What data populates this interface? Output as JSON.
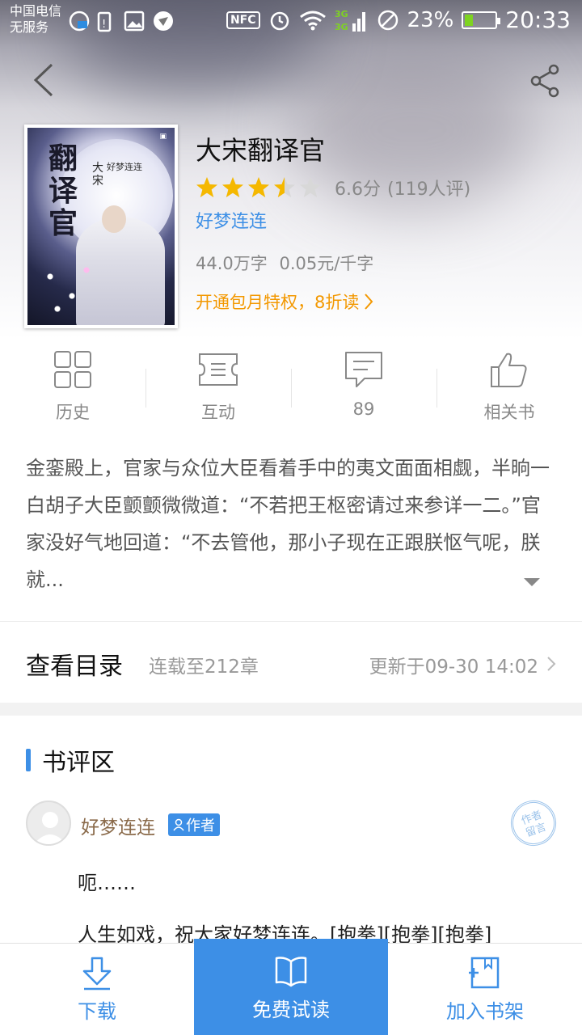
{
  "status_bar": {
    "carrier_line1": "中国电信",
    "carrier_line2": "无服务",
    "nfc": "NFC",
    "network": "3G",
    "battery_pct": "23%",
    "time": "20:33"
  },
  "book": {
    "title": "大宋翻译官",
    "rating_stars": 3.5,
    "score": "6.6分",
    "review_count": "(119人评)",
    "author": "好梦连连",
    "word_count": "44.0万字",
    "price": "0.05元/千字",
    "promo": "开通包月特权，8折读"
  },
  "cover": {
    "title_chars": "翻译官",
    "subtitle": "大宋",
    "author": "好梦连连"
  },
  "actions": [
    {
      "label": "历史",
      "icon": "grid-icon"
    },
    {
      "label": "互动",
      "icon": "ticket-icon"
    },
    {
      "label": "89",
      "icon": "comment-icon"
    },
    {
      "label": "相关书",
      "icon": "thumbs-up-icon"
    }
  ],
  "synopsis": "金銮殿上，官家与众位大臣看着手中的夷文面面相觑，半晌一白胡子大臣颤颤微微道：“不若把王枢密请过来参详一二。”官家没好气地回道：“不去管他，那小子现在正跟朕怄气呢，朕就...",
  "catalog": {
    "title": "查看目录",
    "status": "连载至212章",
    "updated": "更新于09-30 14:02"
  },
  "reviews": {
    "title": "书评区",
    "items": [
      {
        "user": "好梦连连",
        "badge": "作者",
        "stamp": "作者\n留言",
        "line1": "呃……",
        "line2": "人生如戏，祝大家好梦连连。[抱拳][抱拳][抱拳]"
      }
    ]
  },
  "bottom_bar": {
    "download": "下载",
    "free_read": "免费试读",
    "add_shelf": "加入书架"
  },
  "colors": {
    "accent": "#3d8fe6",
    "promo": "#f39800",
    "star": "#f5b800",
    "star_empty": "#d8d8d8"
  }
}
